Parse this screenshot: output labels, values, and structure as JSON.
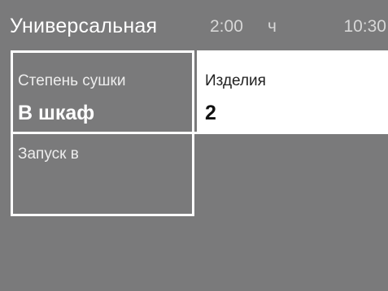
{
  "header": {
    "program_name": "Универсальная",
    "duration": "2:00",
    "duration_unit": "ч",
    "clock": "10:30"
  },
  "settings": {
    "drying_level": {
      "label": "Степень сушки",
      "value": "В шкаф"
    },
    "start_at": {
      "label": "Запуск в"
    },
    "items": {
      "label": "Изделия",
      "value": "2"
    }
  },
  "colors": {
    "background": "#7a7a7b",
    "highlight": "#ffffff",
    "text_light": "#ffffff",
    "text_dark": "#111111"
  }
}
